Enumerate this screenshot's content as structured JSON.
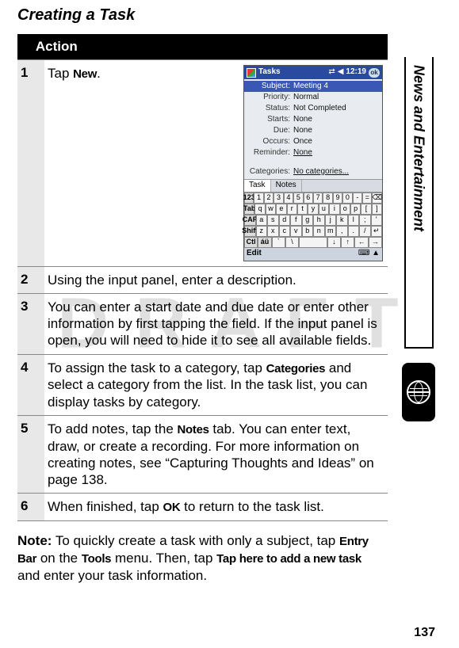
{
  "watermark": "D R A F T",
  "title": "Creating a Task",
  "action_header": "Action",
  "side_label": "News and Entertainment",
  "page_number": "137",
  "steps": {
    "1": {
      "num": "1",
      "pre": "Tap ",
      "bold": "New",
      "post": "."
    },
    "2": {
      "num": "2",
      "text": "Using the input panel, enter a description."
    },
    "3": {
      "num": "3",
      "text": "You can enter a start date and due date or enter other information by first tapping the field. If the input panel is open, you will need to hide it to see all available fields."
    },
    "4": {
      "num": "4",
      "pre": "To assign the task to a category, tap ",
      "bold": "Categories",
      "post": " and select a category from the list. In the task list, you can display tasks by category."
    },
    "5": {
      "num": "5",
      "pre": "To add notes, tap the ",
      "bold": "Notes",
      "post": " tab. You can enter text, draw, or create a recording. For more information on creating notes, see “Capturing Thoughts and Ideas” on page 138."
    },
    "6": {
      "num": "6",
      "pre": "When finished, tap ",
      "bold": "OK",
      "post": " to return to the task list."
    }
  },
  "note": {
    "label": "Note:",
    "p1": " To quickly create a task with only a subject, tap ",
    "b1": "Entry Bar",
    "p2": " on the ",
    "b2": "Tools",
    "p3": " menu. Then, tap ",
    "b3": "Tap here to add a new task",
    "p4": " and enter your task information."
  },
  "screenshot": {
    "title": "Tasks",
    "time": "12:19",
    "ok": "ok",
    "fields": {
      "subject_lbl": "Subject:",
      "subject_val": "Meeting 4",
      "priority_lbl": "Priority:",
      "priority_val": "Normal",
      "status_lbl": "Status:",
      "status_val": "Not Completed",
      "starts_lbl": "Starts:",
      "starts_val": "None",
      "due_lbl": "Due:",
      "due_val": "None",
      "occurs_lbl": "Occurs:",
      "occurs_val": "Once",
      "reminder_lbl": "Reminder:",
      "reminder_val": "None",
      "categories_lbl": "Categories:",
      "categories_val": "No categories..."
    },
    "tabs": {
      "task": "Task",
      "notes": "Notes"
    },
    "kb": {
      "r1": [
        "123",
        "1",
        "2",
        "3",
        "4",
        "5",
        "6",
        "7",
        "8",
        "9",
        "0",
        "-",
        "=",
        "⌫"
      ],
      "r2": [
        "Tab",
        "q",
        "w",
        "e",
        "r",
        "t",
        "y",
        "u",
        "i",
        "o",
        "p",
        "[",
        "]"
      ],
      "r3": [
        "CAP",
        "a",
        "s",
        "d",
        "f",
        "g",
        "h",
        "j",
        "k",
        "l",
        ";",
        "'"
      ],
      "r4": [
        "Shift",
        "z",
        "x",
        "c",
        "v",
        "b",
        "n",
        "m",
        ",",
        ".",
        "/",
        "↵"
      ],
      "r5": [
        "Ctl",
        "áü",
        "`",
        "\\",
        " ",
        "↓",
        "↑",
        "←",
        "→"
      ]
    },
    "bottombar": {
      "edit": "Edit",
      "kb_icon": "⌨",
      "up": "▲"
    }
  }
}
